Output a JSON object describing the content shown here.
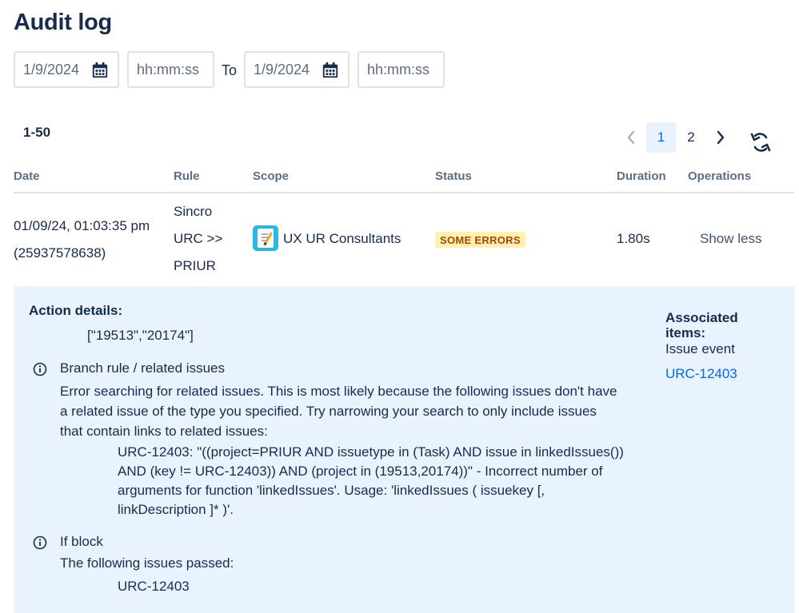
{
  "page": {
    "title": "Audit log"
  },
  "filters": {
    "from_date": "1/9/2024",
    "from_time_placeholder": "hh:mm:ss",
    "to_label": "To",
    "to_date": "1/9/2024",
    "to_time_placeholder": "hh:mm:ss"
  },
  "results": {
    "range": "1-50"
  },
  "pagination": {
    "pages": [
      "1",
      "2"
    ],
    "current": "1"
  },
  "table": {
    "headers": [
      "Date",
      "Rule",
      "Scope",
      "Status",
      "Duration",
      "Operations"
    ],
    "rows": [
      {
        "date_line1": "01/09/24, 01:03:35 pm",
        "date_line2": "(25937578638)",
        "rule_lines": [
          "Sincro",
          "URC >>",
          "PRIUR"
        ],
        "scope": "UX UR Consultants",
        "status": "SOME ERRORS",
        "duration": "1.80s",
        "operation": "Show less"
      }
    ]
  },
  "details": {
    "action_details_label": "Action details:",
    "action_details_value": "[\"19513\",\"20174\"]",
    "items": [
      {
        "title": "Branch rule / related issues",
        "message_lines": [
          "Error searching for related issues. This is most likely because the following issues don't have",
          "a related issue of the type you specified. Try narrowing your search to only include issues",
          "that contain links to related issues:"
        ],
        "detail_lines": [
          "URC-12403: \"((project=PRIUR AND issuetype in (Task) AND issue in linkedIssues())",
          "AND (key != URC-12403)) AND (project in (19513,20174))\" - Incorrect number of",
          "arguments for function 'linkedIssues'. Usage: 'linkedIssues ( issuekey [,",
          "linkDescription ]* )'."
        ]
      },
      {
        "title": "If block",
        "message_lines": [
          "The following issues passed:"
        ],
        "detail_lines": [
          "URC-12403"
        ]
      }
    ],
    "associated": {
      "label_line1": "Associated",
      "label_line2": "items:",
      "type": "Issue event",
      "link": "URC-12403"
    }
  },
  "colors": {
    "link": "#0c66e4",
    "details_bg": "#e9f2ff",
    "badge_bg": "#fff0b3",
    "badge_text": "#a54800",
    "heading": "#172b4d",
    "scope_icon": "#2ab8e0"
  },
  "icons": [
    "calendar-icon",
    "chevron-left-icon",
    "chevron-right-icon",
    "refresh-icon",
    "info-icon",
    "project-icon"
  ]
}
